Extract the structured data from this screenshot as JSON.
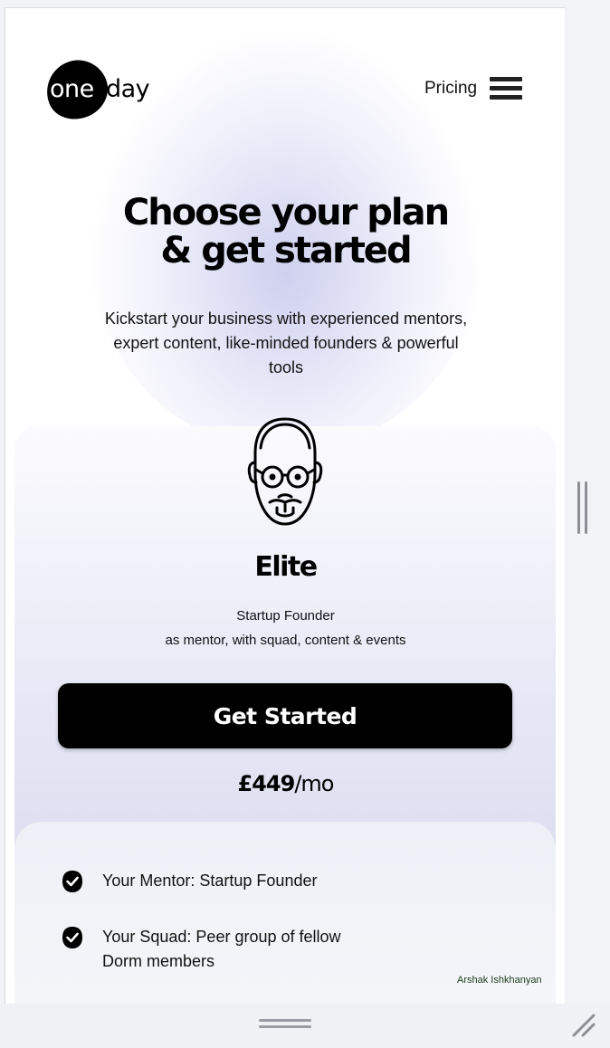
{
  "header": {
    "logo_one": "one",
    "logo_day": "day",
    "nav_pricing": "Pricing",
    "menu_icon": "hamburger-menu-icon"
  },
  "hero": {
    "title_line1": "Choose your plan",
    "title_line2": "& get started",
    "subtitle_line1": "Kickstart your business with experienced mentors,",
    "subtitle_line2": "expert content, like-minded founders & powerful",
    "subtitle_line3": "tools"
  },
  "plan": {
    "avatar_icon": "mentor-face-icon",
    "name": "Elite",
    "line1": "Startup Founder",
    "line2": "as mentor, with squad, content & events",
    "cta_label": "Get Started",
    "price": "£449",
    "price_unit": "/mo"
  },
  "features": [
    {
      "icon": "check-badge-icon",
      "line1": "Your Mentor: Startup Founder",
      "line2": ""
    },
    {
      "icon": "check-badge-icon",
      "line1": "Your Squad: Peer group of fellow",
      "line2": "Dorm members"
    }
  ],
  "credit": "Arshak Ishkhanyan",
  "colors": {
    "accent": "#000000",
    "card_gradient_top": "#fbfbfe",
    "card_gradient_bottom": "#cfd1ea",
    "background": "#ffffff"
  }
}
